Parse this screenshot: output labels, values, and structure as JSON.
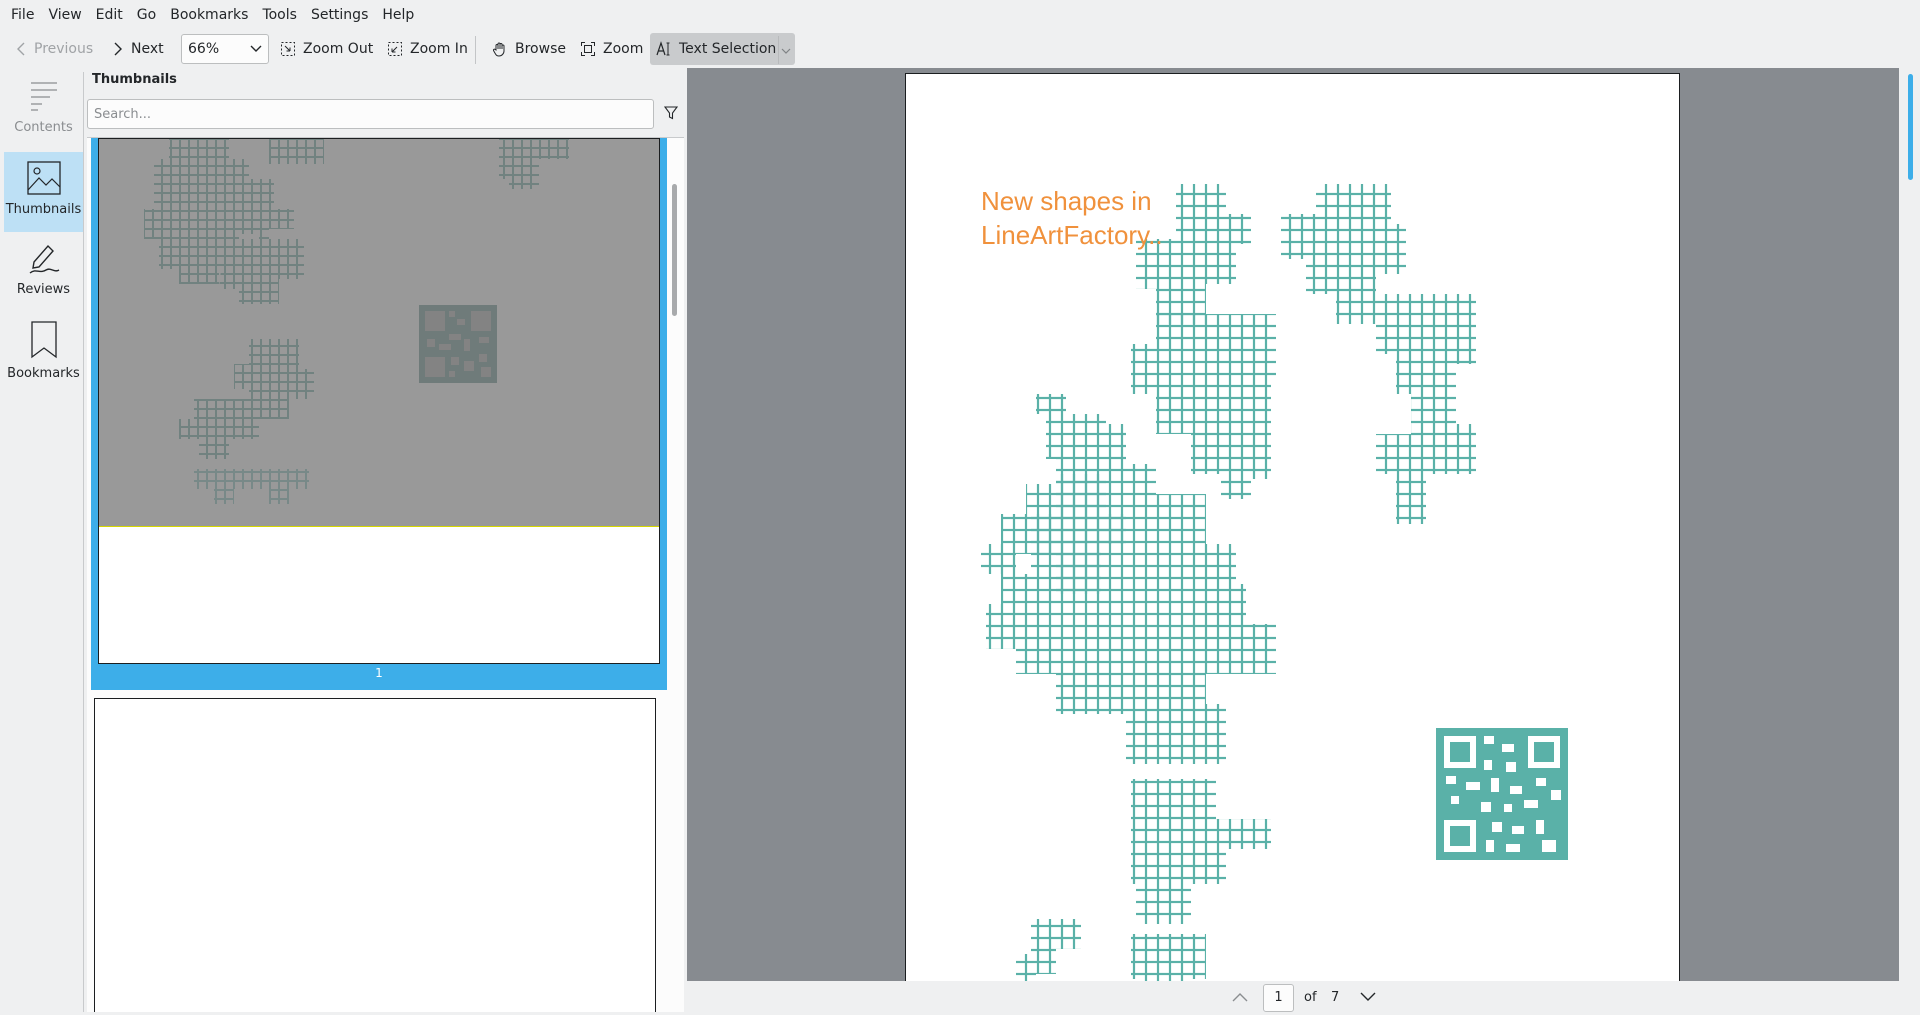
{
  "menu": [
    "File",
    "View",
    "Edit",
    "Go",
    "Bookmarks",
    "Tools",
    "Settings",
    "Help"
  ],
  "toolbar": {
    "previous": "Previous",
    "next": "Next",
    "zoom_value": "66%",
    "zoom_out": "Zoom Out",
    "zoom_in": "Zoom In",
    "browse": "Browse",
    "zoom": "Zoom",
    "text_selection": "Text Selection"
  },
  "sidebar": {
    "items": [
      {
        "label": "Contents",
        "icon": "contents-icon"
      },
      {
        "label": "Thumbnails",
        "icon": "thumbnails-icon"
      },
      {
        "label": "Reviews",
        "icon": "reviews-icon"
      },
      {
        "label": "Bookmarks",
        "icon": "bookmarks-icon"
      }
    ]
  },
  "thumbnails": {
    "title": "Thumbnails",
    "search_placeholder": "Search...",
    "page1_label": "1"
  },
  "document": {
    "heading_line1": "New shapes in",
    "heading_line2": "LineArtFactory..",
    "art_color": "#5ab1a8",
    "heading_color": "#f0913c"
  },
  "navigation": {
    "current_page": "1",
    "of": "of",
    "total_pages": "7"
  },
  "colors": {
    "accent": "#3daee9",
    "selected_bg": "#bde0f5"
  }
}
